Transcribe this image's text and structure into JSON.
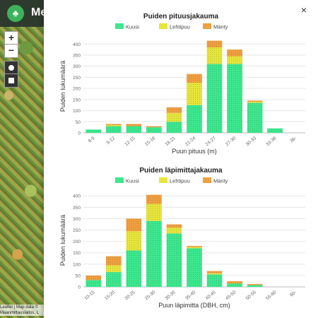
{
  "header": {
    "app_name": "Metsä",
    "logo_icon": "tree-icon"
  },
  "map": {
    "zoom_in": "+",
    "zoom_out": "−",
    "attribution_line1": "Leaflet | Map data ©",
    "attribution_line2": "Maanmittauslaitos, L"
  },
  "panel": {
    "close_label": "×"
  },
  "colors": {
    "Kuusi": "#3de88e",
    "Lehtipuu": "#e6e63c",
    "Mänty": "#f0a040"
  },
  "chart_data": [
    {
      "type": "bar",
      "stacked": true,
      "title": "Puiden pituusjakauma",
      "xlabel": "Puun pituus (m)",
      "ylabel": "Puiden lukumäärä",
      "categories": [
        "6-9",
        "9-12",
        "12-15",
        "15-18",
        "18-21",
        "21-24",
        "24-27",
        "27-30",
        "30-33",
        "33-36",
        "36-"
      ],
      "series": [
        {
          "name": "Kuusi",
          "values": [
            15,
            30,
            30,
            25,
            50,
            125,
            310,
            310,
            135,
            20,
            0
          ]
        },
        {
          "name": "Lehtipuu",
          "values": [
            0,
            5,
            0,
            0,
            40,
            100,
            75,
            35,
            5,
            0,
            0
          ]
        },
        {
          "name": "Mänty",
          "values": [
            0,
            5,
            10,
            5,
            25,
            40,
            30,
            30,
            5,
            0,
            0
          ]
        }
      ],
      "yticks": [
        0,
        50,
        100,
        150,
        200,
        250,
        300,
        350,
        400
      ],
      "ylim": [
        0,
        420
      ],
      "legend": "top"
    },
    {
      "type": "bar",
      "stacked": true,
      "title": "Puiden läpimittajakauma",
      "xlabel": "Puun läpimitta (DBH, cm)",
      "ylabel": "Puiden lukumäärä",
      "categories": [
        "10-15",
        "15-20",
        "20-25",
        "25-30",
        "30-35",
        "35-40",
        "40-45",
        "45-50",
        "50-55",
        "55-60",
        "60-"
      ],
      "series": [
        {
          "name": "Kuusi",
          "values": [
            30,
            65,
            160,
            290,
            235,
            170,
            55,
            15,
            8,
            0,
            0
          ]
        },
        {
          "name": "Lehtipuu",
          "values": [
            0,
            30,
            85,
            75,
            25,
            5,
            5,
            0,
            0,
            0,
            0
          ]
        },
        {
          "name": "Mänty",
          "values": [
            20,
            40,
            55,
            40,
            15,
            5,
            10,
            10,
            5,
            0,
            0
          ]
        }
      ],
      "yticks": [
        0,
        50,
        100,
        150,
        200,
        250,
        300,
        350,
        400
      ],
      "ylim": [
        0,
        410
      ],
      "legend": "top"
    }
  ]
}
